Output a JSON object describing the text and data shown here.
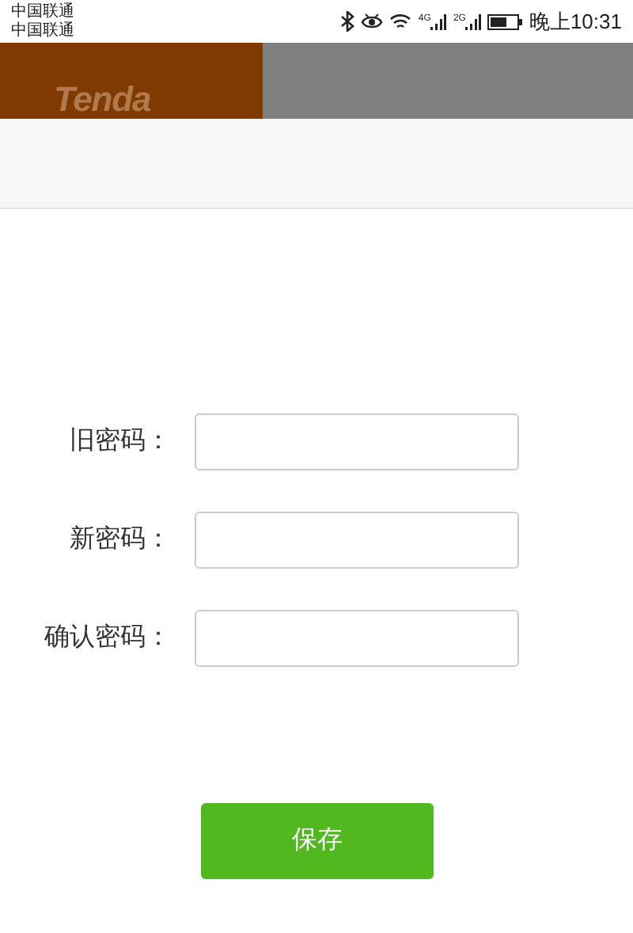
{
  "status_bar": {
    "carriers": [
      "中国联通",
      "中国联通"
    ],
    "network_labels": [
      "4G",
      "2G"
    ],
    "time": "晚上10:31"
  },
  "header": {
    "logo": "Tenda"
  },
  "form": {
    "fields": [
      {
        "label": "旧密码："
      },
      {
        "label": "新密码："
      },
      {
        "label": "确认密码："
      }
    ],
    "save_button": "保存"
  }
}
